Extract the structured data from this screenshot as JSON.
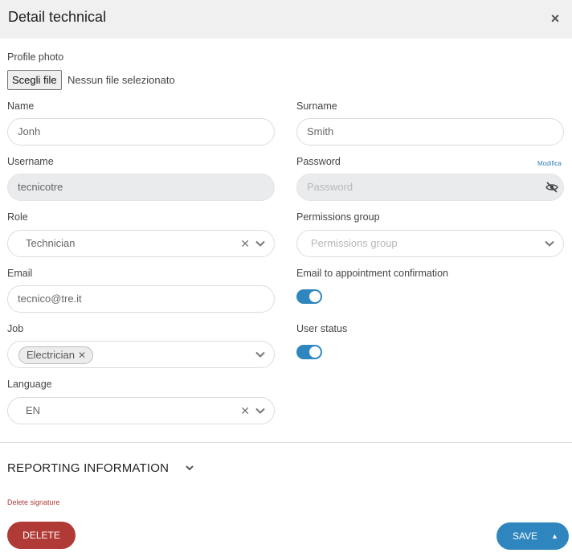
{
  "header": {
    "title": "Detail technical",
    "close_icon": "×"
  },
  "profile_photo": {
    "label": "Profile photo",
    "button_label": "Scegli file",
    "status": "Nessun file selezionato"
  },
  "name": {
    "label": "Name",
    "value": "Jonh"
  },
  "surname": {
    "label": "Surname",
    "value": "Smith"
  },
  "username": {
    "label": "Username",
    "value": "tecnicotre"
  },
  "password": {
    "label": "Password",
    "placeholder": "Password",
    "edit_link": "Modifica"
  },
  "role": {
    "label": "Role",
    "value": "Technician"
  },
  "permissions_group": {
    "label": "Permissions group",
    "placeholder": "Permissions group"
  },
  "email": {
    "label": "Email",
    "value": "tecnico@tre.it"
  },
  "email_confirmation": {
    "label": "Email to appointment confirmation",
    "enabled": true
  },
  "job": {
    "label": "Job",
    "chips": [
      "Electrician"
    ]
  },
  "user_status": {
    "label": "User status",
    "enabled": true
  },
  "language": {
    "label": "Language",
    "value": "EN"
  },
  "reporting": {
    "title": "REPORTING INFORMATION"
  },
  "delete_signature": "Delete signature",
  "footer": {
    "delete_label": "DELETE",
    "save_label": "SAVE"
  },
  "colors": {
    "primary": "#2f86be",
    "danger": "#b03a35",
    "header_bg": "#f0f0f0"
  }
}
